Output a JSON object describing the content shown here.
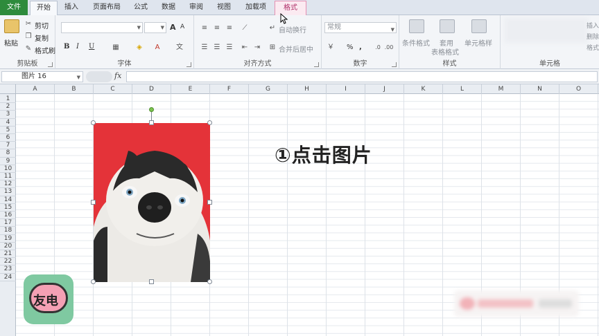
{
  "tabs": [
    {
      "id": "file",
      "label": "文件"
    },
    {
      "id": "home",
      "label": "开始"
    },
    {
      "id": "insert",
      "label": "插入"
    },
    {
      "id": "layout",
      "label": "页面布局"
    },
    {
      "id": "formulas",
      "label": "公式"
    },
    {
      "id": "data",
      "label": "数据"
    },
    {
      "id": "review",
      "label": "审阅"
    },
    {
      "id": "view",
      "label": "视图"
    },
    {
      "id": "addins",
      "label": "加载项"
    },
    {
      "id": "format",
      "label": "格式"
    }
  ],
  "ribbon": {
    "clipboard": {
      "paste": "粘贴",
      "cut": "剪切",
      "copy": "复制",
      "format_painter": "格式刷",
      "label": "剪贴板"
    },
    "font": {
      "label": "字体",
      "bold": "B",
      "italic": "I",
      "underline": "U",
      "grow": "A",
      "shrink": "A"
    },
    "alignment": {
      "label": "对齐方式",
      "wrap_text": "自动换行",
      "merge_center": "合并后居中"
    },
    "number": {
      "label": "数字",
      "format_value": "常规",
      "percent": "%",
      "comma": ","
    },
    "styles": {
      "label": "样式",
      "conditional": "条件格式",
      "table_format_1": "套用",
      "table_format_2": "表格格式",
      "cell_styles": "单元格样"
    },
    "cells": {
      "label": "单元格",
      "insert": "插入",
      "delete": "删除",
      "format": "格式"
    }
  },
  "formula_bar": {
    "name_box": "图片 16",
    "fx": "fx"
  },
  "columns": [
    "A",
    "B",
    "C",
    "D",
    "E",
    "F",
    "G",
    "H",
    "I",
    "J",
    "K",
    "L",
    "M",
    "N",
    "O"
  ],
  "rows": [
    "1",
    "2",
    "3",
    "4",
    "5",
    "6",
    "7",
    "8",
    "9",
    "10",
    "11",
    "12",
    "13",
    "14",
    "15",
    "16",
    "17",
    "18",
    "19",
    "20",
    "21",
    "22",
    "23",
    "24"
  ],
  "annotation": "①点击图片",
  "logo_text": "友电",
  "colors": {
    "file_tab": "#2e8b3c",
    "format_tab": "#b0306a",
    "picture_bg": "#e43339"
  }
}
